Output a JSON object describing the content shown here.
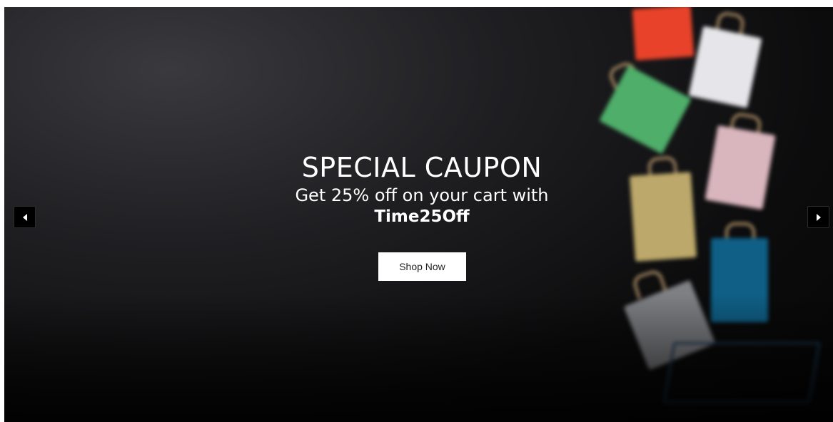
{
  "slide": {
    "title": "SPECIAL CAUPON",
    "subtitle": "Get 25% off on your cart with",
    "code": "Time25Off",
    "button_label": "Shop Now"
  },
  "icons": {
    "prev": "chevron-left-icon",
    "next": "chevron-right-icon"
  },
  "colors": {
    "background": "#0c0c0d",
    "text": "#ffffff",
    "button_bg": "#ffffff",
    "button_text": "#222222"
  }
}
